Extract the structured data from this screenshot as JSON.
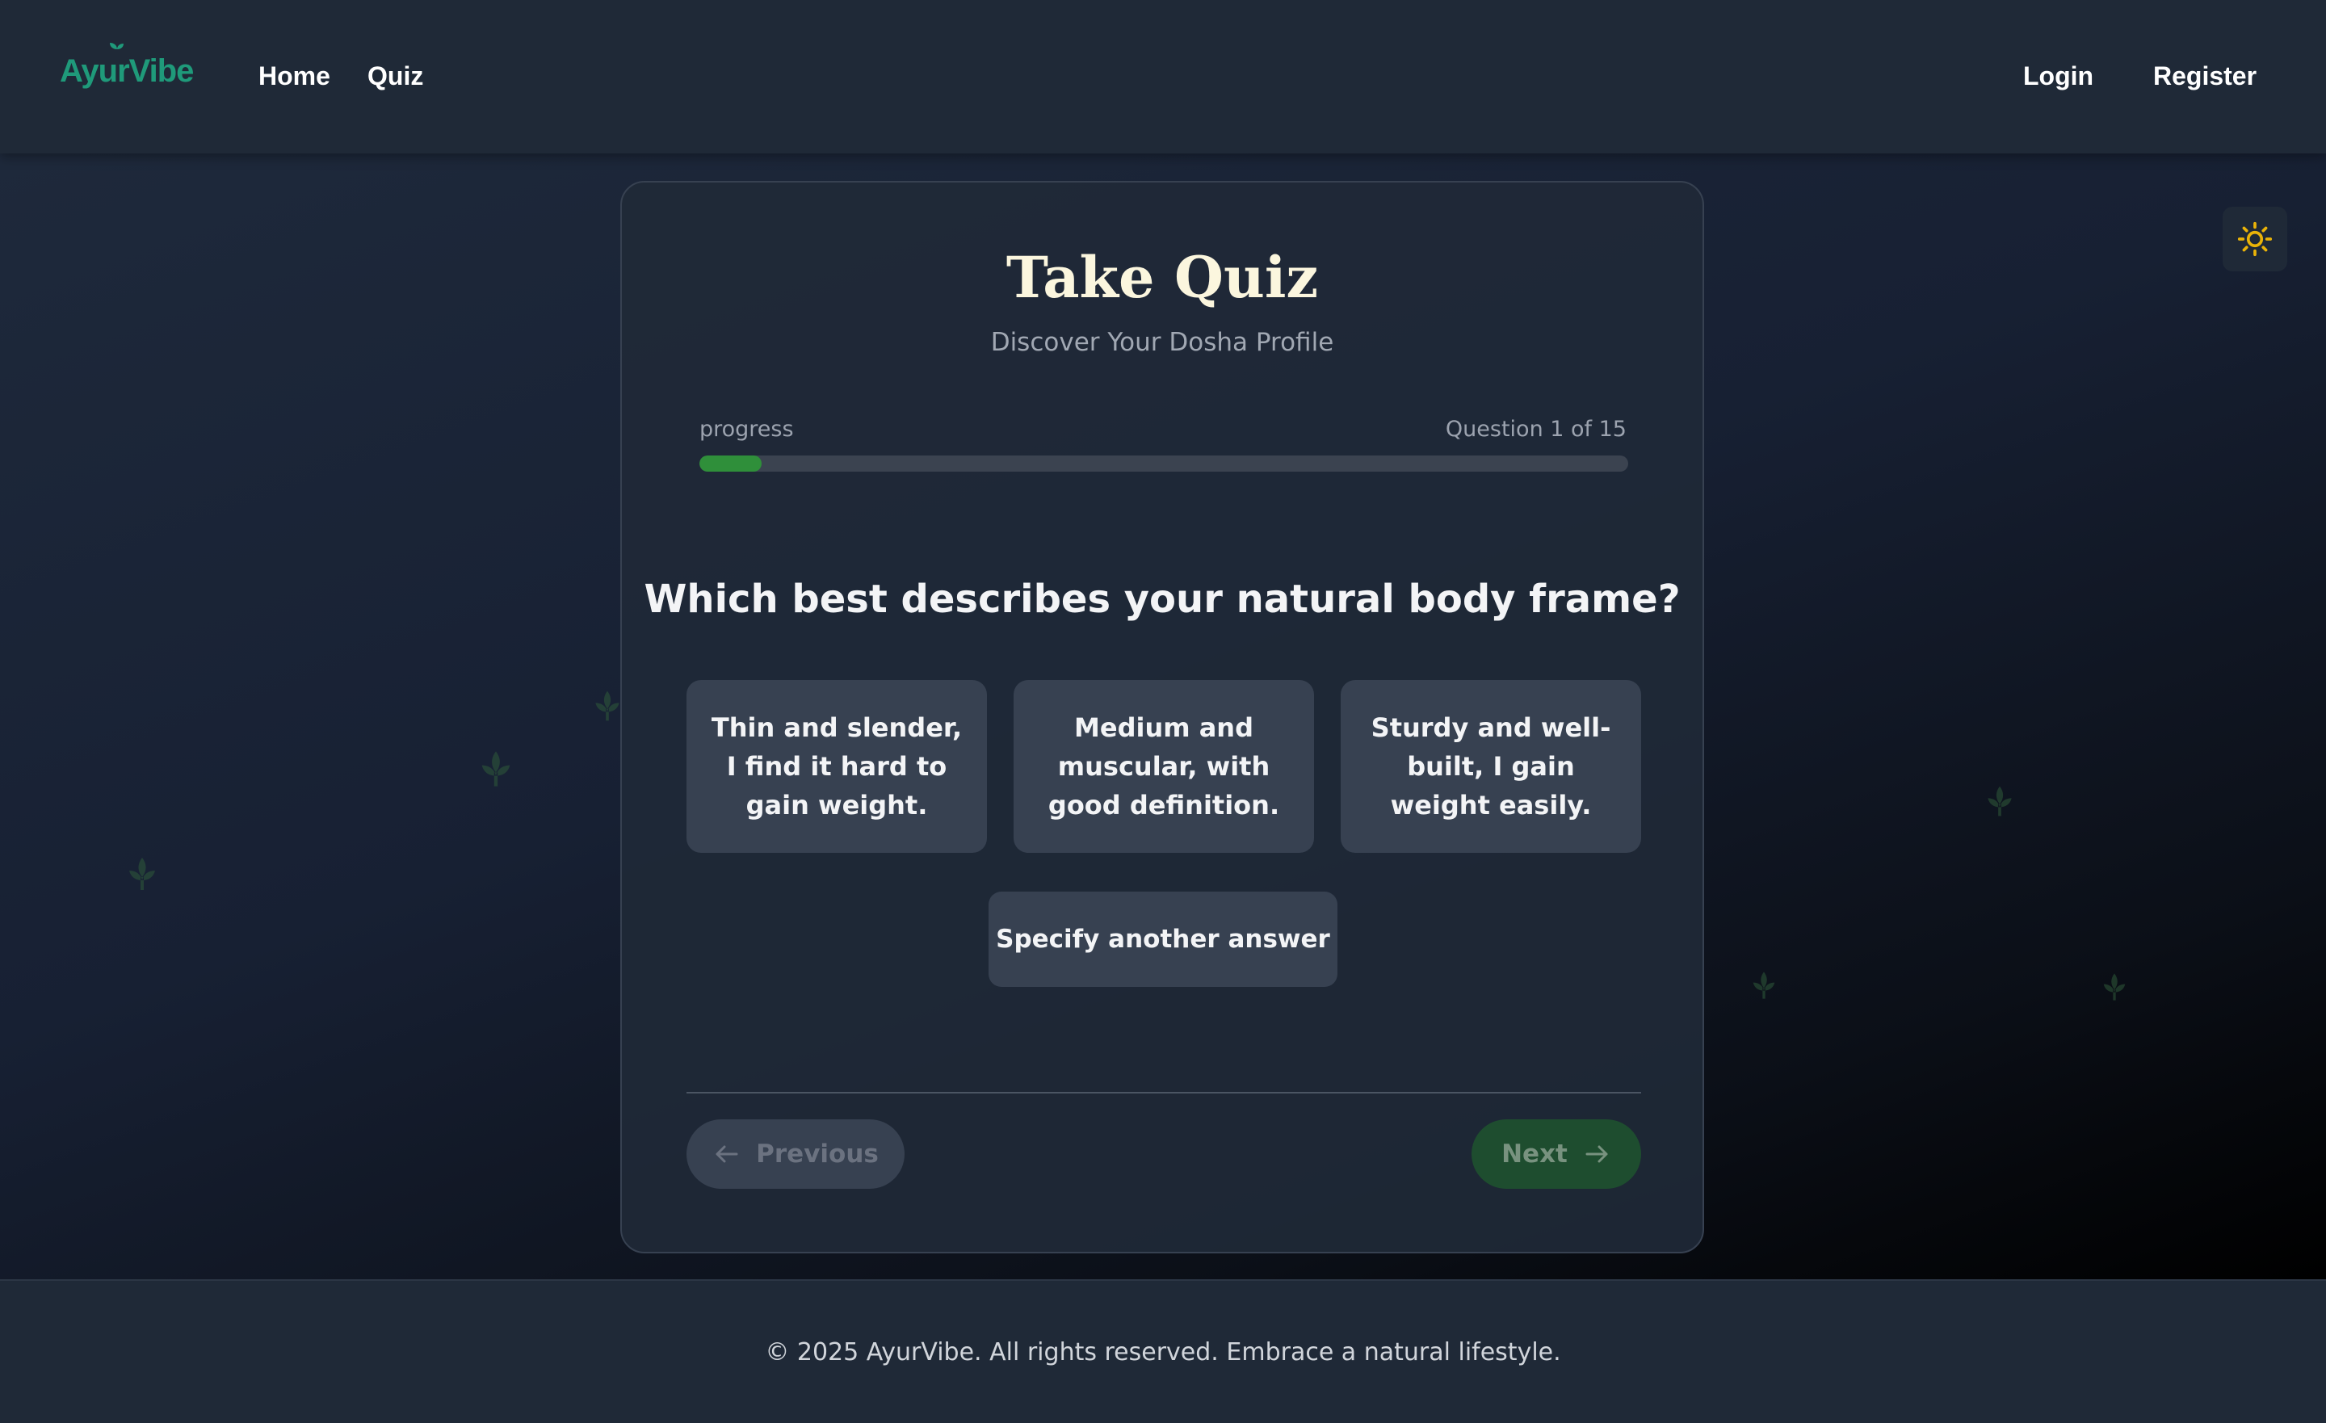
{
  "header": {
    "logo": "AyurVibe",
    "nav": {
      "home": "Home",
      "quiz": "Quiz",
      "login": "Login",
      "register": "Register"
    }
  },
  "theme_toggle": {
    "icon": "sun-icon",
    "color": "#eab308"
  },
  "quiz": {
    "title": "Take Quiz",
    "subtitle": "Discover Your Dosha Profile",
    "progress_label": "progress",
    "question_counter": "Question 1 of 15",
    "progress_fraction": 0.0667,
    "question": "Which best describes your natural body frame?",
    "options": [
      "Thin and slender, I find it hard to gain weight.",
      "Medium and muscular, with good definition.",
      "Sturdy and well-built, I gain weight easily."
    ],
    "other_option": "Specify another answer",
    "prev_button": "Previous",
    "next_button": "Next"
  },
  "footer": {
    "copyright": "© 2025 AyurVibe. All rights reserved. Embrace a natural lifestyle."
  },
  "colors": {
    "brand": "#1f9a7a",
    "progress_fill": "#2f8f3a",
    "next_button_bg": "#1e4d2f",
    "title": "#fbf6de"
  }
}
